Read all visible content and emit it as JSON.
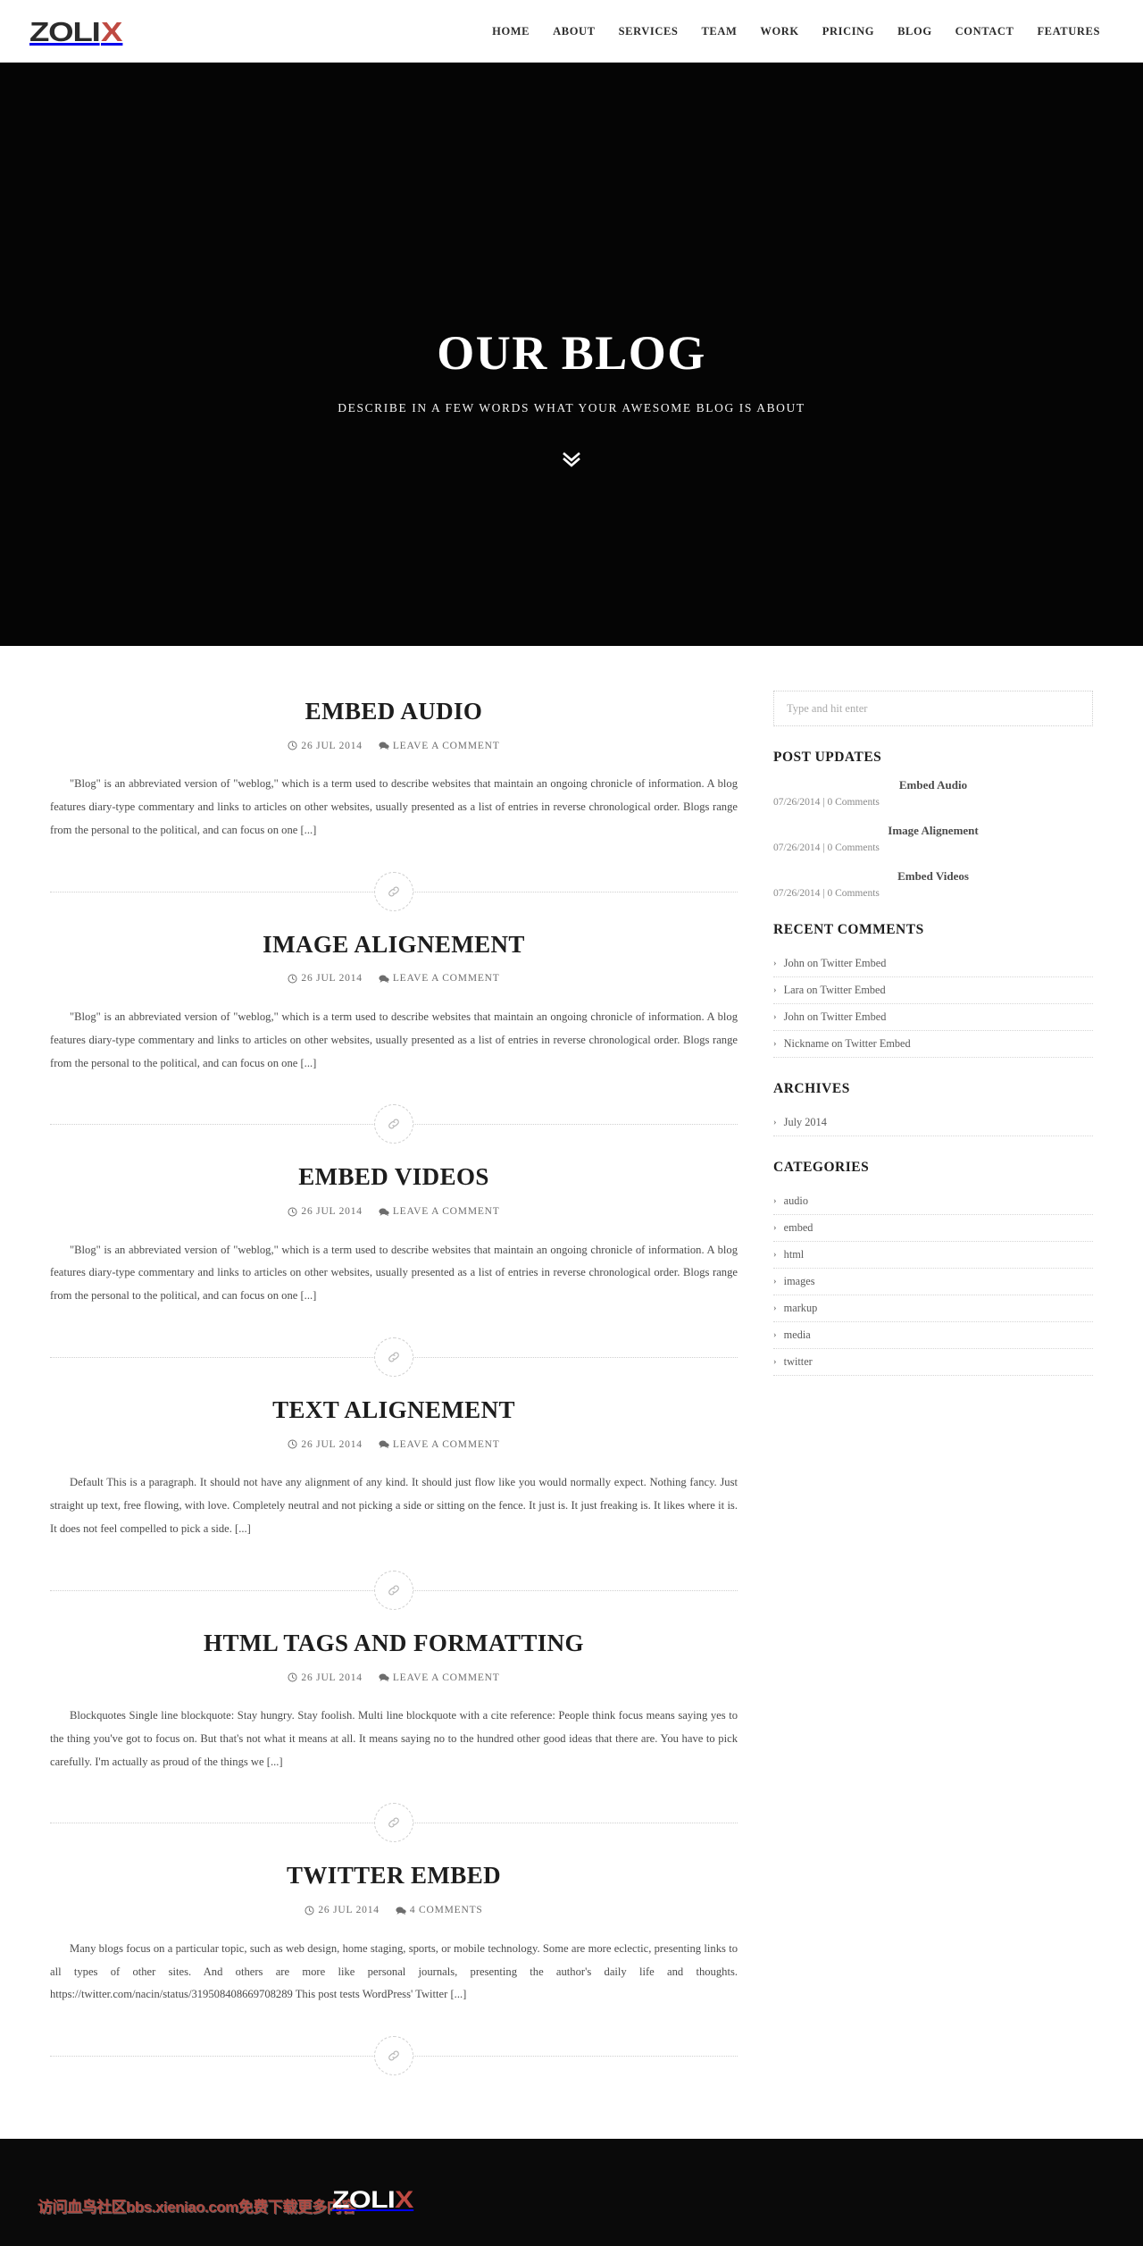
{
  "brand": {
    "logo_dark": "ZOLI",
    "logo_accent": "X",
    "accent_color": "#bf4a42",
    "dark_color": "#2b2b2b"
  },
  "nav": {
    "items": [
      {
        "label": "HOME"
      },
      {
        "label": "ABOUT"
      },
      {
        "label": "SERVICES"
      },
      {
        "label": "TEAM"
      },
      {
        "label": "WORK"
      },
      {
        "label": "PRICING"
      },
      {
        "label": "BLOG"
      },
      {
        "label": "CONTACT"
      },
      {
        "label": "FEATURES"
      }
    ]
  },
  "hero": {
    "title": "OUR BLOG",
    "subtitle": "DESCRIBE IN A FEW WORDS WHAT YOUR AWESOME BLOG IS ABOUT",
    "scroll_icon": "chevron-double-down-icon",
    "background_color": "#050505"
  },
  "posts": [
    {
      "title": "EMBED AUDIO",
      "date": "26 JUL 2014",
      "comments": "LEAVE A COMMENT",
      "excerpt": "\"Blog\" is an abbreviated version of \"weblog,\" which is a term used to describe websites that maintain an ongoing chronicle of information. A blog features diary-type commentary and links to articles on other websites, usually presented as a list of entries in reverse chronological order. Blogs range from the personal to the political, and can focus on one [...]"
    },
    {
      "title": "IMAGE ALIGNEMENT",
      "date": "26 JUL 2014",
      "comments": "LEAVE A COMMENT",
      "excerpt": "\"Blog\" is an abbreviated version of \"weblog,\" which is a term used to describe websites that maintain an ongoing chronicle of information. A blog features diary-type commentary and links to articles on other websites, usually presented as a list of entries in reverse chronological order. Blogs range from the personal to the political, and can focus on one [...]"
    },
    {
      "title": "EMBED VIDEOS",
      "date": "26 JUL 2014",
      "comments": "LEAVE A COMMENT",
      "excerpt": "\"Blog\" is an abbreviated version of \"weblog,\" which is a term used to describe websites that maintain an ongoing chronicle of information. A blog features diary-type commentary and links to articles on other websites, usually presented as a list of entries in reverse chronological order. Blogs range from the personal to the political, and can focus on one [...]"
    },
    {
      "title": "TEXT ALIGNEMENT",
      "date": "26 JUL 2014",
      "comments": "LEAVE A COMMENT",
      "excerpt": "Default This is a paragraph. It should not have any alignment of any kind. It should just flow like you would normally expect. Nothing fancy. Just straight up text, free flowing, with love. Completely neutral and not picking a side or sitting on the fence. It just is. It just freaking is. It likes where it is. It does not feel compelled to pick a side. [...]"
    },
    {
      "title": "HTML TAGS AND FORMATTING",
      "date": "26 JUL 2014",
      "comments": "LEAVE A COMMENT",
      "excerpt": "Blockquotes Single line blockquote: Stay hungry. Stay foolish. Multi line blockquote with a cite reference: People think focus means saying yes to the thing you've got to focus on. But that's not what it means at all. It means saying no to the hundred other good ideas that there are. You have to pick carefully. I'm actually as proud of the things we [...]"
    },
    {
      "title": "TWITTER EMBED",
      "date": "26 JUL 2014",
      "comments": "4 COMMENTS",
      "excerpt": "Many blogs focus on a particular topic, such as web design, home staging, sports, or mobile technology. Some are more eclectic, presenting links to all types of other sites. And others are more like personal journals, presenting the author's daily life and thoughts. https://twitter.com/nacin/status/319508408669708289 This post tests WordPress' Twitter [...]"
    }
  ],
  "sidebar": {
    "search": {
      "placeholder": "Type and hit enter",
      "value": ""
    },
    "post_updates": {
      "title": "POST UPDATES",
      "items": [
        {
          "title": "Embed Audio",
          "meta": "07/26/2014 | 0 Comments"
        },
        {
          "title": "Image Alignement",
          "meta": "07/26/2014 | 0 Comments"
        },
        {
          "title": "Embed Videos",
          "meta": "07/26/2014 | 0 Comments"
        }
      ]
    },
    "recent_comments": {
      "title": "RECENT COMMENTS",
      "items": [
        {
          "label": "John on Twitter Embed"
        },
        {
          "label": "Lara on Twitter Embed"
        },
        {
          "label": "John on Twitter Embed"
        },
        {
          "label": "Nickname on Twitter Embed"
        }
      ]
    },
    "archives": {
      "title": "ARCHIVES",
      "items": [
        {
          "label": "July 2014"
        }
      ]
    },
    "categories": {
      "title": "CATEGORIES",
      "items": [
        {
          "label": "audio"
        },
        {
          "label": "embed"
        },
        {
          "label": "html"
        },
        {
          "label": "images"
        },
        {
          "label": "markup"
        },
        {
          "label": "media"
        },
        {
          "label": "twitter"
        }
      ]
    }
  },
  "footer": {
    "watermark": "访问血鸟社区bbs.xieniao.com免费下载更多内容",
    "logo_dark": "ZOLI",
    "logo_accent": "X",
    "background_color": "#0a0a0a"
  },
  "icons": {
    "clock": "clock-icon",
    "comment": "comment-icon",
    "link": "link-icon",
    "chevron_right": "›"
  }
}
